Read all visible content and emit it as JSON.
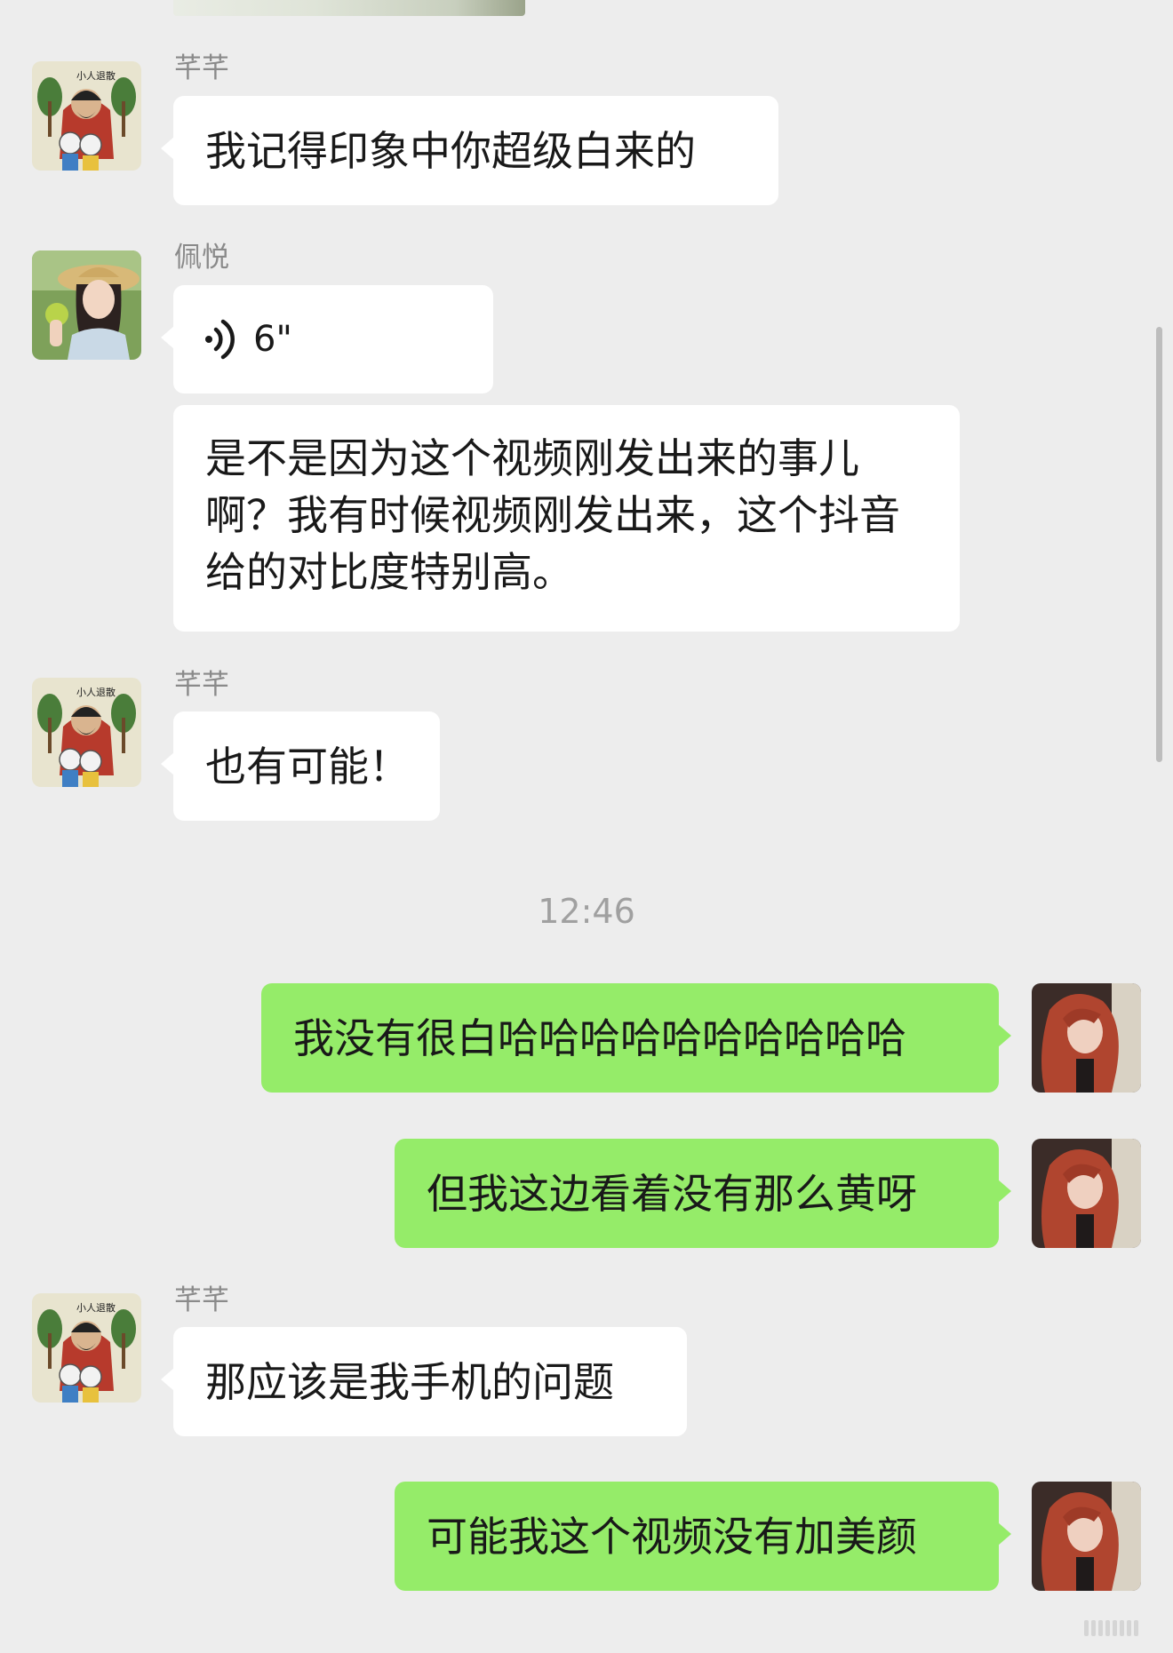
{
  "contacts": {
    "qianqian": {
      "name": "芊芊"
    },
    "peiyue": {
      "name": "佩悦"
    }
  },
  "messages": {
    "m1": "我记得印象中你超级白来的",
    "m2_voice_duration": "6\"",
    "m3": "是不是因为这个视频刚发出来的事儿啊？我有时候视频刚发出来，这个抖音给的对比度特别高。",
    "m4": "也有可能！",
    "timestamp": "12:46",
    "m5": "我没有很白哈哈哈哈哈哈哈哈哈哈",
    "m6": "但我这边看着没有那么黄呀",
    "m7": "那应该是我手机的问题",
    "m8": "可能我这个视频没有加美颜"
  },
  "avatar_labels": {
    "qianqian_avatar_text": "小人退散"
  },
  "colors": {
    "background": "#ededed",
    "incoming_bubble": "#ffffff",
    "outgoing_bubble": "#95ec69",
    "name_text": "#8a8a8a",
    "timestamp_text": "#a0a0a0"
  },
  "icons": {
    "voice": "voice-wave-icon"
  }
}
